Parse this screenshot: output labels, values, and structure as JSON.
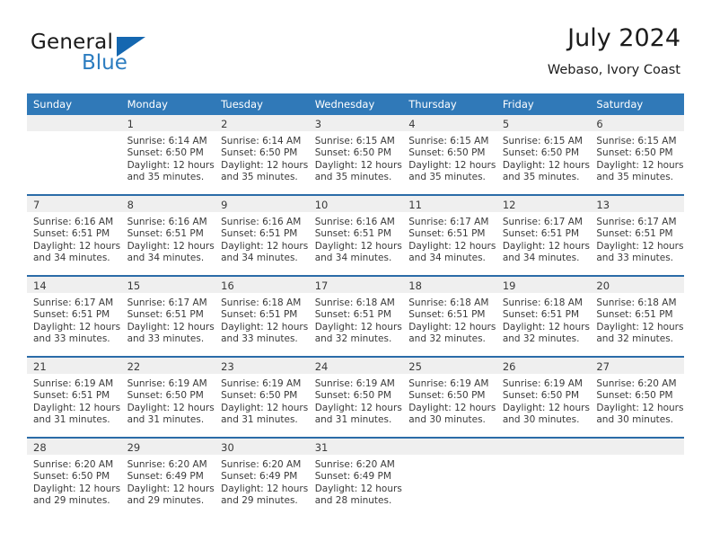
{
  "brand": {
    "name_part1": "General",
    "name_part2": "Blue",
    "logo_icon": "triangle-logo-icon"
  },
  "header": {
    "title": "July 2024",
    "subtitle": "Webaso, Ivory Coast"
  },
  "weekday_headers": [
    "Sunday",
    "Monday",
    "Tuesday",
    "Wednesday",
    "Thursday",
    "Friday",
    "Saturday"
  ],
  "colors": {
    "header_blue": "#3079b8",
    "separator_blue": "#2b6ca8",
    "daynum_band": "#efefef",
    "brand_blue": "#2b7cc0",
    "text": "#3a3a3a"
  },
  "weeks": [
    [
      {
        "day": "",
        "sunrise": "",
        "sunset": "",
        "daylight1": "",
        "daylight2": ""
      },
      {
        "day": "1",
        "sunrise": "Sunrise: 6:14 AM",
        "sunset": "Sunset: 6:50 PM",
        "daylight1": "Daylight: 12 hours",
        "daylight2": "and 35 minutes."
      },
      {
        "day": "2",
        "sunrise": "Sunrise: 6:14 AM",
        "sunset": "Sunset: 6:50 PM",
        "daylight1": "Daylight: 12 hours",
        "daylight2": "and 35 minutes."
      },
      {
        "day": "3",
        "sunrise": "Sunrise: 6:15 AM",
        "sunset": "Sunset: 6:50 PM",
        "daylight1": "Daylight: 12 hours",
        "daylight2": "and 35 minutes."
      },
      {
        "day": "4",
        "sunrise": "Sunrise: 6:15 AM",
        "sunset": "Sunset: 6:50 PM",
        "daylight1": "Daylight: 12 hours",
        "daylight2": "and 35 minutes."
      },
      {
        "day": "5",
        "sunrise": "Sunrise: 6:15 AM",
        "sunset": "Sunset: 6:50 PM",
        "daylight1": "Daylight: 12 hours",
        "daylight2": "and 35 minutes."
      },
      {
        "day": "6",
        "sunrise": "Sunrise: 6:15 AM",
        "sunset": "Sunset: 6:50 PM",
        "daylight1": "Daylight: 12 hours",
        "daylight2": "and 35 minutes."
      }
    ],
    [
      {
        "day": "7",
        "sunrise": "Sunrise: 6:16 AM",
        "sunset": "Sunset: 6:51 PM",
        "daylight1": "Daylight: 12 hours",
        "daylight2": "and 34 minutes."
      },
      {
        "day": "8",
        "sunrise": "Sunrise: 6:16 AM",
        "sunset": "Sunset: 6:51 PM",
        "daylight1": "Daylight: 12 hours",
        "daylight2": "and 34 minutes."
      },
      {
        "day": "9",
        "sunrise": "Sunrise: 6:16 AM",
        "sunset": "Sunset: 6:51 PM",
        "daylight1": "Daylight: 12 hours",
        "daylight2": "and 34 minutes."
      },
      {
        "day": "10",
        "sunrise": "Sunrise: 6:16 AM",
        "sunset": "Sunset: 6:51 PM",
        "daylight1": "Daylight: 12 hours",
        "daylight2": "and 34 minutes."
      },
      {
        "day": "11",
        "sunrise": "Sunrise: 6:17 AM",
        "sunset": "Sunset: 6:51 PM",
        "daylight1": "Daylight: 12 hours",
        "daylight2": "and 34 minutes."
      },
      {
        "day": "12",
        "sunrise": "Sunrise: 6:17 AM",
        "sunset": "Sunset: 6:51 PM",
        "daylight1": "Daylight: 12 hours",
        "daylight2": "and 34 minutes."
      },
      {
        "day": "13",
        "sunrise": "Sunrise: 6:17 AM",
        "sunset": "Sunset: 6:51 PM",
        "daylight1": "Daylight: 12 hours",
        "daylight2": "and 33 minutes."
      }
    ],
    [
      {
        "day": "14",
        "sunrise": "Sunrise: 6:17 AM",
        "sunset": "Sunset: 6:51 PM",
        "daylight1": "Daylight: 12 hours",
        "daylight2": "and 33 minutes."
      },
      {
        "day": "15",
        "sunrise": "Sunrise: 6:17 AM",
        "sunset": "Sunset: 6:51 PM",
        "daylight1": "Daylight: 12 hours",
        "daylight2": "and 33 minutes."
      },
      {
        "day": "16",
        "sunrise": "Sunrise: 6:18 AM",
        "sunset": "Sunset: 6:51 PM",
        "daylight1": "Daylight: 12 hours",
        "daylight2": "and 33 minutes."
      },
      {
        "day": "17",
        "sunrise": "Sunrise: 6:18 AM",
        "sunset": "Sunset: 6:51 PM",
        "daylight1": "Daylight: 12 hours",
        "daylight2": "and 32 minutes."
      },
      {
        "day": "18",
        "sunrise": "Sunrise: 6:18 AM",
        "sunset": "Sunset: 6:51 PM",
        "daylight1": "Daylight: 12 hours",
        "daylight2": "and 32 minutes."
      },
      {
        "day": "19",
        "sunrise": "Sunrise: 6:18 AM",
        "sunset": "Sunset: 6:51 PM",
        "daylight1": "Daylight: 12 hours",
        "daylight2": "and 32 minutes."
      },
      {
        "day": "20",
        "sunrise": "Sunrise: 6:18 AM",
        "sunset": "Sunset: 6:51 PM",
        "daylight1": "Daylight: 12 hours",
        "daylight2": "and 32 minutes."
      }
    ],
    [
      {
        "day": "21",
        "sunrise": "Sunrise: 6:19 AM",
        "sunset": "Sunset: 6:51 PM",
        "daylight1": "Daylight: 12 hours",
        "daylight2": "and 31 minutes."
      },
      {
        "day": "22",
        "sunrise": "Sunrise: 6:19 AM",
        "sunset": "Sunset: 6:50 PM",
        "daylight1": "Daylight: 12 hours",
        "daylight2": "and 31 minutes."
      },
      {
        "day": "23",
        "sunrise": "Sunrise: 6:19 AM",
        "sunset": "Sunset: 6:50 PM",
        "daylight1": "Daylight: 12 hours",
        "daylight2": "and 31 minutes."
      },
      {
        "day": "24",
        "sunrise": "Sunrise: 6:19 AM",
        "sunset": "Sunset: 6:50 PM",
        "daylight1": "Daylight: 12 hours",
        "daylight2": "and 31 minutes."
      },
      {
        "day": "25",
        "sunrise": "Sunrise: 6:19 AM",
        "sunset": "Sunset: 6:50 PM",
        "daylight1": "Daylight: 12 hours",
        "daylight2": "and 30 minutes."
      },
      {
        "day": "26",
        "sunrise": "Sunrise: 6:19 AM",
        "sunset": "Sunset: 6:50 PM",
        "daylight1": "Daylight: 12 hours",
        "daylight2": "and 30 minutes."
      },
      {
        "day": "27",
        "sunrise": "Sunrise: 6:20 AM",
        "sunset": "Sunset: 6:50 PM",
        "daylight1": "Daylight: 12 hours",
        "daylight2": "and 30 minutes."
      }
    ],
    [
      {
        "day": "28",
        "sunrise": "Sunrise: 6:20 AM",
        "sunset": "Sunset: 6:50 PM",
        "daylight1": "Daylight: 12 hours",
        "daylight2": "and 29 minutes."
      },
      {
        "day": "29",
        "sunrise": "Sunrise: 6:20 AM",
        "sunset": "Sunset: 6:49 PM",
        "daylight1": "Daylight: 12 hours",
        "daylight2": "and 29 minutes."
      },
      {
        "day": "30",
        "sunrise": "Sunrise: 6:20 AM",
        "sunset": "Sunset: 6:49 PM",
        "daylight1": "Daylight: 12 hours",
        "daylight2": "and 29 minutes."
      },
      {
        "day": "31",
        "sunrise": "Sunrise: 6:20 AM",
        "sunset": "Sunset: 6:49 PM",
        "daylight1": "Daylight: 12 hours",
        "daylight2": "and 28 minutes."
      },
      {
        "day": "",
        "sunrise": "",
        "sunset": "",
        "daylight1": "",
        "daylight2": ""
      },
      {
        "day": "",
        "sunrise": "",
        "sunset": "",
        "daylight1": "",
        "daylight2": ""
      },
      {
        "day": "",
        "sunrise": "",
        "sunset": "",
        "daylight1": "",
        "daylight2": ""
      }
    ]
  ]
}
